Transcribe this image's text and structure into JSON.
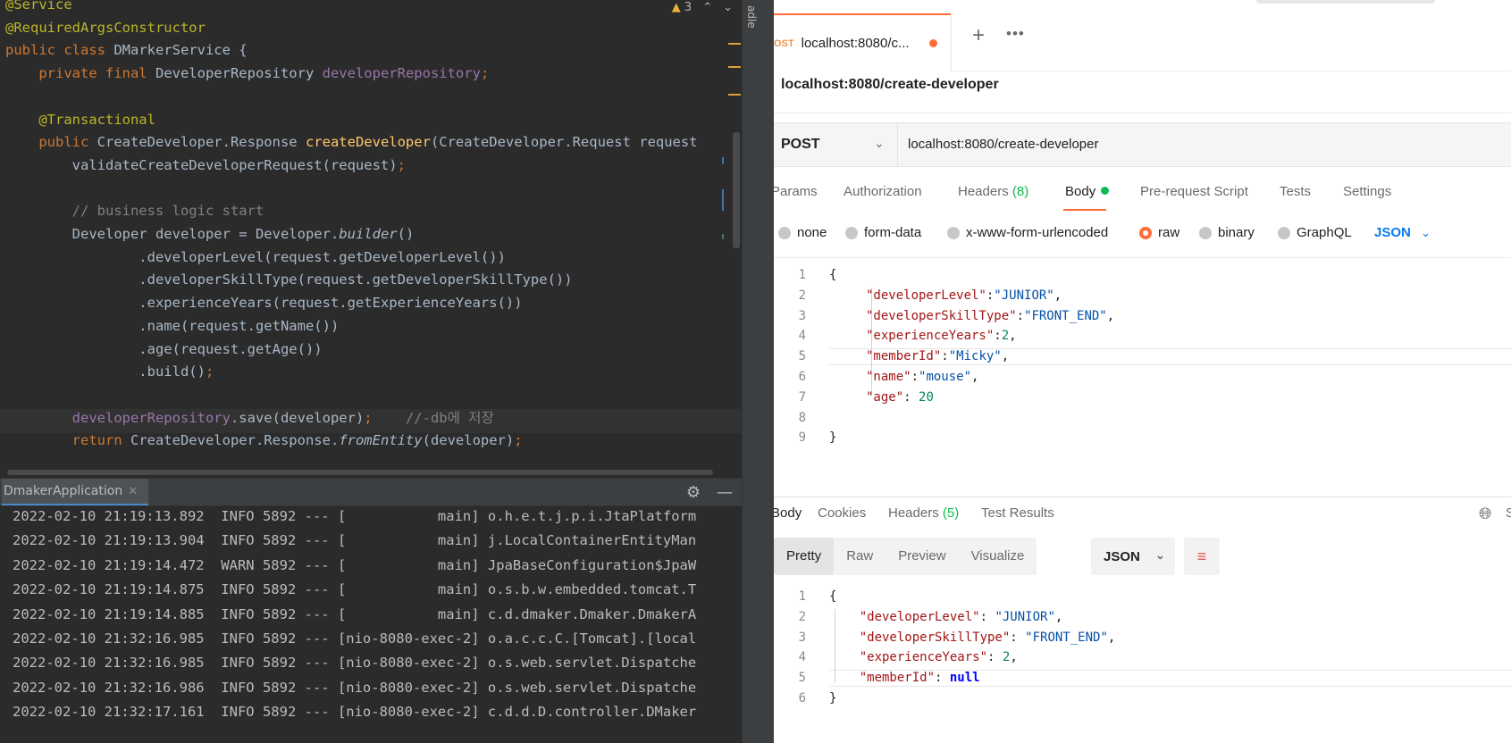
{
  "ide": {
    "warning_count": "3",
    "code_lines": [
      [
        [
          "ann",
          "@Service"
        ]
      ],
      [
        [
          "ann",
          "@RequiredArgsConstructor"
        ]
      ],
      [
        [
          "kw",
          "public class "
        ],
        [
          "pl",
          "DMarkerService {"
        ]
      ],
      [
        [
          "pl",
          "    "
        ],
        [
          "kw",
          "private final "
        ],
        [
          "pl",
          "DeveloperRepository "
        ],
        [
          "fld",
          "developerRepository"
        ],
        [
          "kw",
          ";"
        ]
      ],
      [
        [
          "pl",
          ""
        ]
      ],
      [
        [
          "pl",
          "    "
        ],
        [
          "ann",
          "@Transactional"
        ]
      ],
      [
        [
          "pl",
          "    "
        ],
        [
          "kw",
          "public "
        ],
        [
          "pl",
          "CreateDeveloper.Response "
        ],
        [
          "mth",
          "createDeveloper"
        ],
        [
          "pl",
          "(CreateDeveloper.Request request"
        ]
      ],
      [
        [
          "pl",
          "        validateCreateDeveloperRequest(request)"
        ],
        [
          "kw",
          ";"
        ]
      ],
      [
        [
          "pl",
          ""
        ]
      ],
      [
        [
          "cmt",
          "        // business logic start"
        ]
      ],
      [
        [
          "pl",
          "        Developer developer = Developer."
        ],
        [
          "sm",
          "builder"
        ],
        [
          "pl",
          "()"
        ]
      ],
      [
        [
          "pl",
          "                .developerLevel(request.getDeveloperLevel())"
        ]
      ],
      [
        [
          "pl",
          "                .developerSkillType(request.getDeveloperSkillType())"
        ]
      ],
      [
        [
          "pl",
          "                .experienceYears(request.getExperienceYears())"
        ]
      ],
      [
        [
          "pl",
          "                .name(request.getName())"
        ]
      ],
      [
        [
          "pl",
          "                .age(request.getAge())"
        ]
      ],
      [
        [
          "pl",
          "                .build()"
        ],
        [
          "kw",
          ";"
        ]
      ],
      [
        [
          "pl",
          ""
        ]
      ],
      [
        [
          "pl",
          "        "
        ],
        [
          "fld",
          "developerRepository"
        ],
        [
          "pl",
          ".save(developer)"
        ],
        [
          "kw",
          ";"
        ],
        [
          "cmt",
          "    //-db에 저장"
        ]
      ],
      [
        [
          "pl",
          "        "
        ],
        [
          "kw",
          "return "
        ],
        [
          "pl",
          "CreateDeveloper.Response."
        ],
        [
          "sm",
          "fromEntity"
        ],
        [
          "pl",
          "(developer)"
        ],
        [
          "kw",
          ";"
        ]
      ]
    ],
    "gradle_tab_label": "adle",
    "run_tab_label": "DmakerApplication",
    "console_lines": [
      "2022-02-10 21:19:13.892  INFO 5892 --- [           main] o.h.e.t.j.p.i.JtaPlatform",
      "2022-02-10 21:19:13.904  INFO 5892 --- [           main] j.LocalContainerEntityMan",
      "2022-02-10 21:19:14.472  WARN 5892 --- [           main] JpaBaseConfiguration$JpaW",
      "2022-02-10 21:19:14.875  INFO 5892 --- [           main] o.s.b.w.embedded.tomcat.T",
      "2022-02-10 21:19:14.885  INFO 5892 --- [           main] c.d.dmaker.Dmaker.DmakerA",
      "2022-02-10 21:32:16.985  INFO 5892 --- [nio-8080-exec-2] o.a.c.c.C.[Tomcat].[local",
      "2022-02-10 21:32:16.985  INFO 5892 --- [nio-8080-exec-2] o.s.web.servlet.Dispatche",
      "2022-02-10 21:32:16.986  INFO 5892 --- [nio-8080-exec-2] o.s.web.servlet.Dispatche",
      "2022-02-10 21:32:17.161  INFO 5892 --- [nio-8080-exec-2] c.d.d.D.controller.DMaker"
    ]
  },
  "postman": {
    "tab": {
      "method": "OST",
      "label": "localhost:8080/c..."
    },
    "request_title": "localhost:8080/create-developer",
    "method": "POST",
    "url": "localhost:8080/create-developer",
    "request_tabs": [
      {
        "label": "Params"
      },
      {
        "label": "Authorization"
      },
      {
        "label": "Headers ",
        "count": "(8)"
      },
      {
        "label": "Body",
        "active": true
      },
      {
        "label": "Pre-request Script"
      },
      {
        "label": "Tests"
      },
      {
        "label": "Settings"
      }
    ],
    "body_types": [
      "none",
      "form-data",
      "x-www-form-urlencoded",
      "raw",
      "binary",
      "GraphQL"
    ],
    "body_type_selected": "raw",
    "body_format": "JSON",
    "request_body_lines": [
      [
        [
          "p",
          "{"
        ]
      ],
      [
        [
          "jk",
          "\"developerLevel\""
        ],
        [
          "p",
          ":"
        ],
        [
          "jv",
          "\"JUNIOR\""
        ],
        [
          "p",
          ","
        ]
      ],
      [
        [
          "jk",
          "\"developerSkillType\""
        ],
        [
          "p",
          ":"
        ],
        [
          "jv",
          "\"FRONT_END\""
        ],
        [
          "p",
          ","
        ]
      ],
      [
        [
          "jk",
          "\"experienceYears\""
        ],
        [
          "p",
          ":"
        ],
        [
          "jn",
          "2"
        ],
        [
          "p",
          ","
        ]
      ],
      [
        [
          "jk",
          "\"memberId\""
        ],
        [
          "p",
          ":"
        ],
        [
          "jv",
          "\"Micky\""
        ],
        [
          "p",
          ","
        ]
      ],
      [
        [
          "jk",
          "\"name\""
        ],
        [
          "p",
          ":"
        ],
        [
          "jv",
          "\"mouse\""
        ],
        [
          "p",
          ","
        ]
      ],
      [
        [
          "jk",
          "\"age\""
        ],
        [
          "p",
          ": "
        ],
        [
          "jn",
          "20"
        ]
      ],
      [
        [
          "p",
          ""
        ]
      ],
      [
        [
          "p",
          "}"
        ]
      ]
    ],
    "response_tabs": [
      {
        "label": "Body",
        "active": true
      },
      {
        "label": "Cookies"
      },
      {
        "label": "Headers ",
        "count": "(5)"
      },
      {
        "label": "Test Results"
      }
    ],
    "response_save_label": "S",
    "response_modes": [
      "Pretty",
      "Raw",
      "Preview",
      "Visualize"
    ],
    "response_mode_selected": "Pretty",
    "response_format": "JSON",
    "response_body_lines": [
      [
        [
          "p",
          "{"
        ]
      ],
      [
        [
          "p",
          "    "
        ],
        [
          "jk",
          "\"developerLevel\""
        ],
        [
          "p",
          ": "
        ],
        [
          "jv",
          "\"JUNIOR\""
        ],
        [
          "p",
          ","
        ]
      ],
      [
        [
          "p",
          "    "
        ],
        [
          "jk",
          "\"developerSkillType\""
        ],
        [
          "p",
          ": "
        ],
        [
          "jv",
          "\"FRONT_END\""
        ],
        [
          "p",
          ","
        ]
      ],
      [
        [
          "p",
          "    "
        ],
        [
          "jk",
          "\"experienceYears\""
        ],
        [
          "p",
          ": "
        ],
        [
          "jn",
          "2"
        ],
        [
          "p",
          ","
        ]
      ],
      [
        [
          "p",
          "    "
        ],
        [
          "jk",
          "\"memberId\""
        ],
        [
          "p",
          ": "
        ],
        [
          "jnull",
          "null"
        ]
      ],
      [
        [
          "p",
          "}"
        ]
      ]
    ],
    "colors": {
      "accent": "#ff6c37",
      "green": "#0cbb52",
      "link_blue": "#097bed"
    }
  }
}
